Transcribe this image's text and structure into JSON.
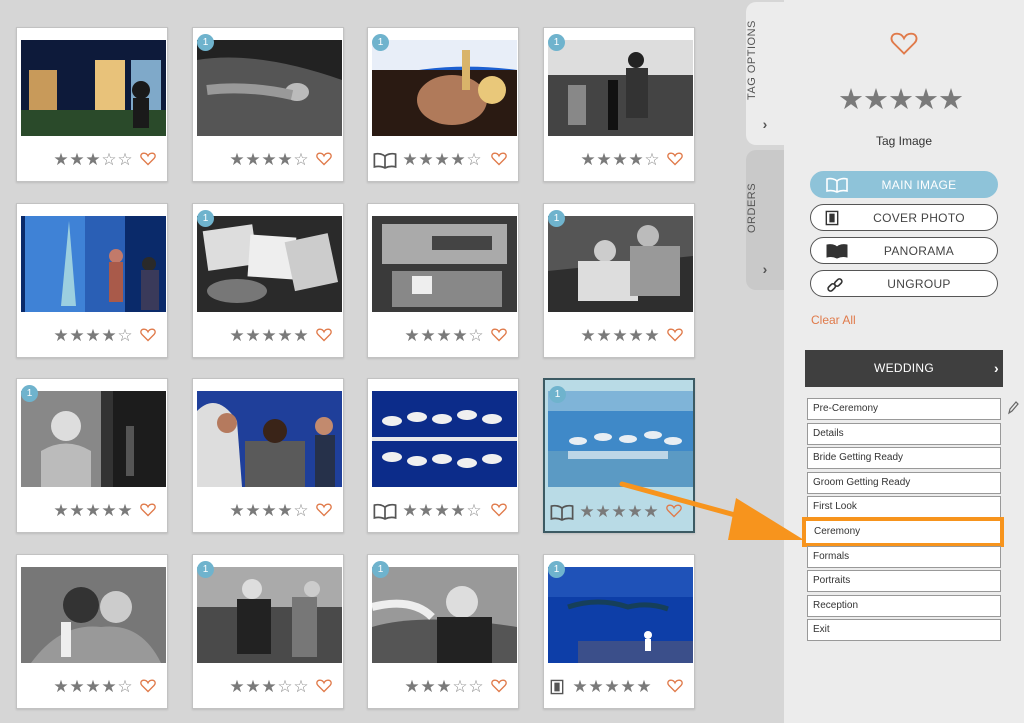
{
  "grid": {
    "cards": [
      {
        "stars": 3,
        "group": "",
        "format": "",
        "selected": false,
        "scene": "window-silhouette"
      },
      {
        "stars": 4,
        "group": "1",
        "format": "",
        "selected": false,
        "scene": "bw-hands"
      },
      {
        "stars": 4,
        "group": "1",
        "format": "book-icon",
        "selected": false,
        "scene": "champagne"
      },
      {
        "stars": 4,
        "group": "1",
        "format": "",
        "selected": false,
        "scene": "bw-room"
      },
      {
        "stars": 4,
        "group": "",
        "format": "",
        "selected": false,
        "scene": "dress-window"
      },
      {
        "stars": 5,
        "group": "1",
        "format": "",
        "selected": false,
        "scene": "bw-letters"
      },
      {
        "stars": 4,
        "group": "",
        "format": "",
        "selected": false,
        "scene": "bw-bed"
      },
      {
        "stars": 5,
        "group": "1",
        "format": "",
        "selected": false,
        "scene": "bw-groomsmen"
      },
      {
        "stars": 5,
        "group": "1",
        "format": "",
        "selected": false,
        "scene": "bw-bride-laugh"
      },
      {
        "stars": 4,
        "group": "",
        "format": "",
        "selected": false,
        "scene": "ceremony-couple"
      },
      {
        "stars": 4,
        "group": "",
        "format": "book-icon",
        "selected": false,
        "scene": "umbrellas-reflection"
      },
      {
        "stars": 5,
        "group": "1",
        "format": "book-icon",
        "selected": true,
        "scene": "rooftop-ceremony"
      },
      {
        "stars": 4,
        "group": "",
        "format": "",
        "selected": false,
        "scene": "bw-hug"
      },
      {
        "stars": 3,
        "group": "1",
        "format": "",
        "selected": false,
        "scene": "bw-groom-dance"
      },
      {
        "stars": 3,
        "group": "1",
        "format": "",
        "selected": false,
        "scene": "bw-groom-face"
      },
      {
        "stars": 5,
        "group": "1",
        "format": "cover-icon",
        "selected": false,
        "scene": "blue-sea"
      }
    ]
  },
  "tabs": {
    "tag_options": "TAG OPTIONS",
    "orders": "ORDERS",
    "chevron": "›"
  },
  "panel": {
    "heart_icon": "heart-outline-icon",
    "rating_stars": 5,
    "tag_image_label": "Tag Image",
    "buttons": [
      {
        "label": "MAIN IMAGE",
        "icon": "book-icon",
        "active": true
      },
      {
        "label": "COVER PHOTO",
        "icon": "cover-icon",
        "active": false
      },
      {
        "label": "PANORAMA",
        "icon": "panorama-icon",
        "active": false
      },
      {
        "label": "UNGROUP",
        "icon": "link-icon",
        "active": false
      }
    ],
    "clear_all": "Clear All",
    "category": "WEDDING",
    "category_chevron": "›",
    "items": [
      "Pre-Ceremony",
      "Details",
      "Bride Getting Ready",
      "Groom Getting Ready",
      "First Look",
      "Ceremony",
      "Formals",
      "Portraits",
      "Reception",
      "Exit"
    ],
    "highlighted_item": "Ceremony"
  },
  "colors": {
    "accent_blue": "#8ec3d9",
    "heart_orange": "#e07a4a",
    "highlight_orange": "#f7941d",
    "dark_header": "#3f3f3f"
  }
}
